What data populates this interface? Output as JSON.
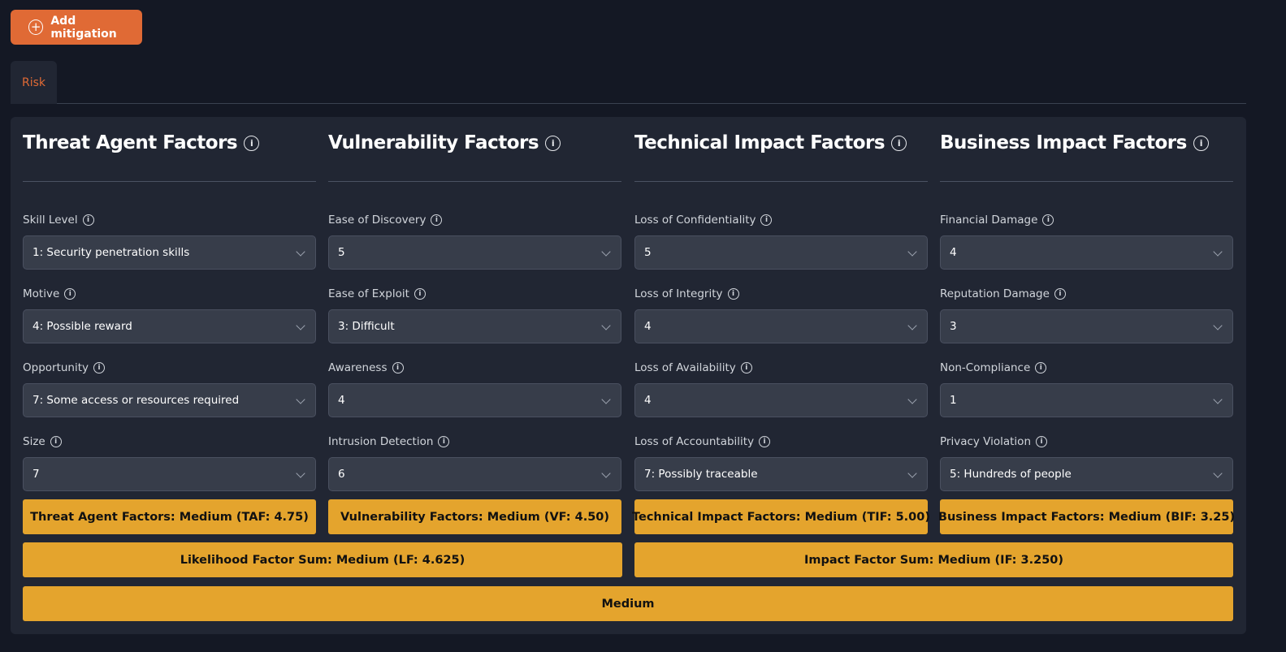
{
  "toolbar": {
    "add_mitigation_label": "Add mitigation"
  },
  "tabs": [
    {
      "label": "Risk"
    }
  ],
  "columns": [
    {
      "title": "Threat Agent Factors",
      "fields": [
        {
          "label": "Skill Level",
          "value": "1: Security penetration skills"
        },
        {
          "label": "Motive",
          "value": "4: Possible reward"
        },
        {
          "label": "Opportunity",
          "value": "7: Some access or resources required"
        },
        {
          "label": "Size",
          "value": "7"
        }
      ],
      "result": "Threat Agent Factors: Medium (TAF: 4.75)"
    },
    {
      "title": "Vulnerability Factors",
      "fields": [
        {
          "label": "Ease of Discovery",
          "value": "5"
        },
        {
          "label": "Ease of Exploit",
          "value": "3: Difficult"
        },
        {
          "label": "Awareness",
          "value": "4"
        },
        {
          "label": "Intrusion Detection",
          "value": "6"
        }
      ],
      "result": "Vulnerability Factors: Medium (VF: 4.50)"
    },
    {
      "title": "Technical Impact Factors",
      "fields": [
        {
          "label": "Loss of Confidentiality",
          "value": "5"
        },
        {
          "label": "Loss of Integrity",
          "value": "4"
        },
        {
          "label": "Loss of Availability",
          "value": "4"
        },
        {
          "label": "Loss of Accountability",
          "value": "7: Possibly traceable"
        }
      ],
      "result": "Technical Impact Factors: Medium (TIF: 5.00)"
    },
    {
      "title": "Business Impact Factors",
      "fields": [
        {
          "label": "Financial Damage",
          "value": "4"
        },
        {
          "label": "Reputation Damage",
          "value": "3"
        },
        {
          "label": "Non-Compliance",
          "value": "1"
        },
        {
          "label": "Privacy Violation",
          "value": "5: Hundreds of people"
        }
      ],
      "result": "Business Impact Factors: Medium (BIF: 3.25)"
    }
  ],
  "summary": {
    "likelihood": "Likelihood Factor Sum: Medium (LF: 4.625)",
    "impact": "Impact Factor Sum: Medium (IF: 3.250)",
    "overall": "Medium"
  },
  "colors": {
    "accent": "#e06a35",
    "result_fill": "#e4a42d",
    "background": "#141824",
    "panel": "#212633"
  },
  "icons": {
    "add": "plus-circle-icon",
    "info": "info-circle-icon",
    "dropdown": "chevron-down-icon"
  }
}
